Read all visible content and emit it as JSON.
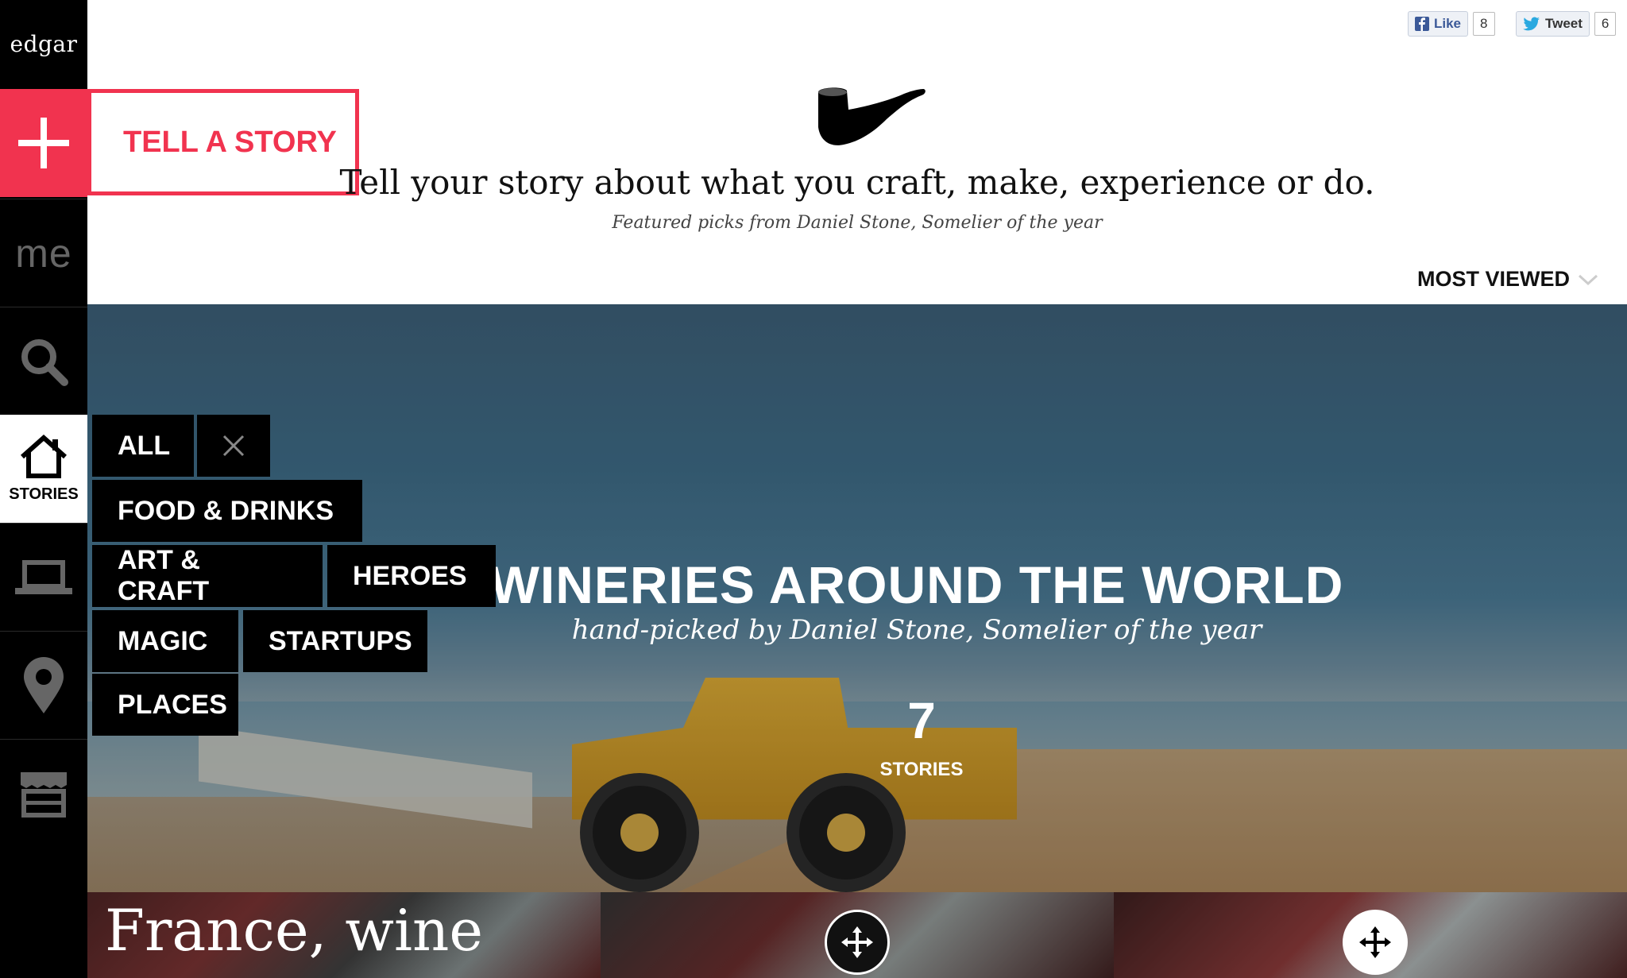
{
  "sidebar": {
    "logo": "edgar",
    "items": [
      {
        "id": "tell-story-plus",
        "icon": "plus-icon"
      },
      {
        "id": "me",
        "label": "me"
      },
      {
        "id": "search",
        "icon": "search-icon"
      },
      {
        "id": "stories",
        "icon": "house-icon",
        "label": "STORIES",
        "active": true
      },
      {
        "id": "laptop",
        "icon": "laptop-icon"
      },
      {
        "id": "places",
        "icon": "map-pin-icon"
      },
      {
        "id": "shop",
        "icon": "shop-icon"
      }
    ]
  },
  "tell_story": {
    "label": "TELL A STORY"
  },
  "social": {
    "like_label": "Like",
    "like_count": "8",
    "tweet_label": "Tweet",
    "tweet_count": "6"
  },
  "header": {
    "logo_icon": "pipe-icon",
    "tagline": "Tell your story about what you craft, make, experience or do.",
    "subtitle": "Featured picks from Daniel Stone, Somelier of the year",
    "sort_label": "MOST VIEWED"
  },
  "hero": {
    "title": "WINERIES AROUND THE WORLD",
    "subtitle": "hand-picked by Daniel Stone, Somelier of the year",
    "count": "7",
    "count_label": "STORIES"
  },
  "categories": {
    "all": "ALL",
    "items": [
      "FOOD & DRINKS",
      "ART & CRAFT",
      "HEROES",
      "MAGIC",
      "STARTUPS",
      "PLACES"
    ]
  },
  "bottom": {
    "tiles": [
      {
        "title": "France, wine"
      },
      {
        "title": ""
      },
      {
        "title": ""
      }
    ]
  },
  "colors": {
    "accent": "#f1334f",
    "sidebar": "#000000"
  }
}
